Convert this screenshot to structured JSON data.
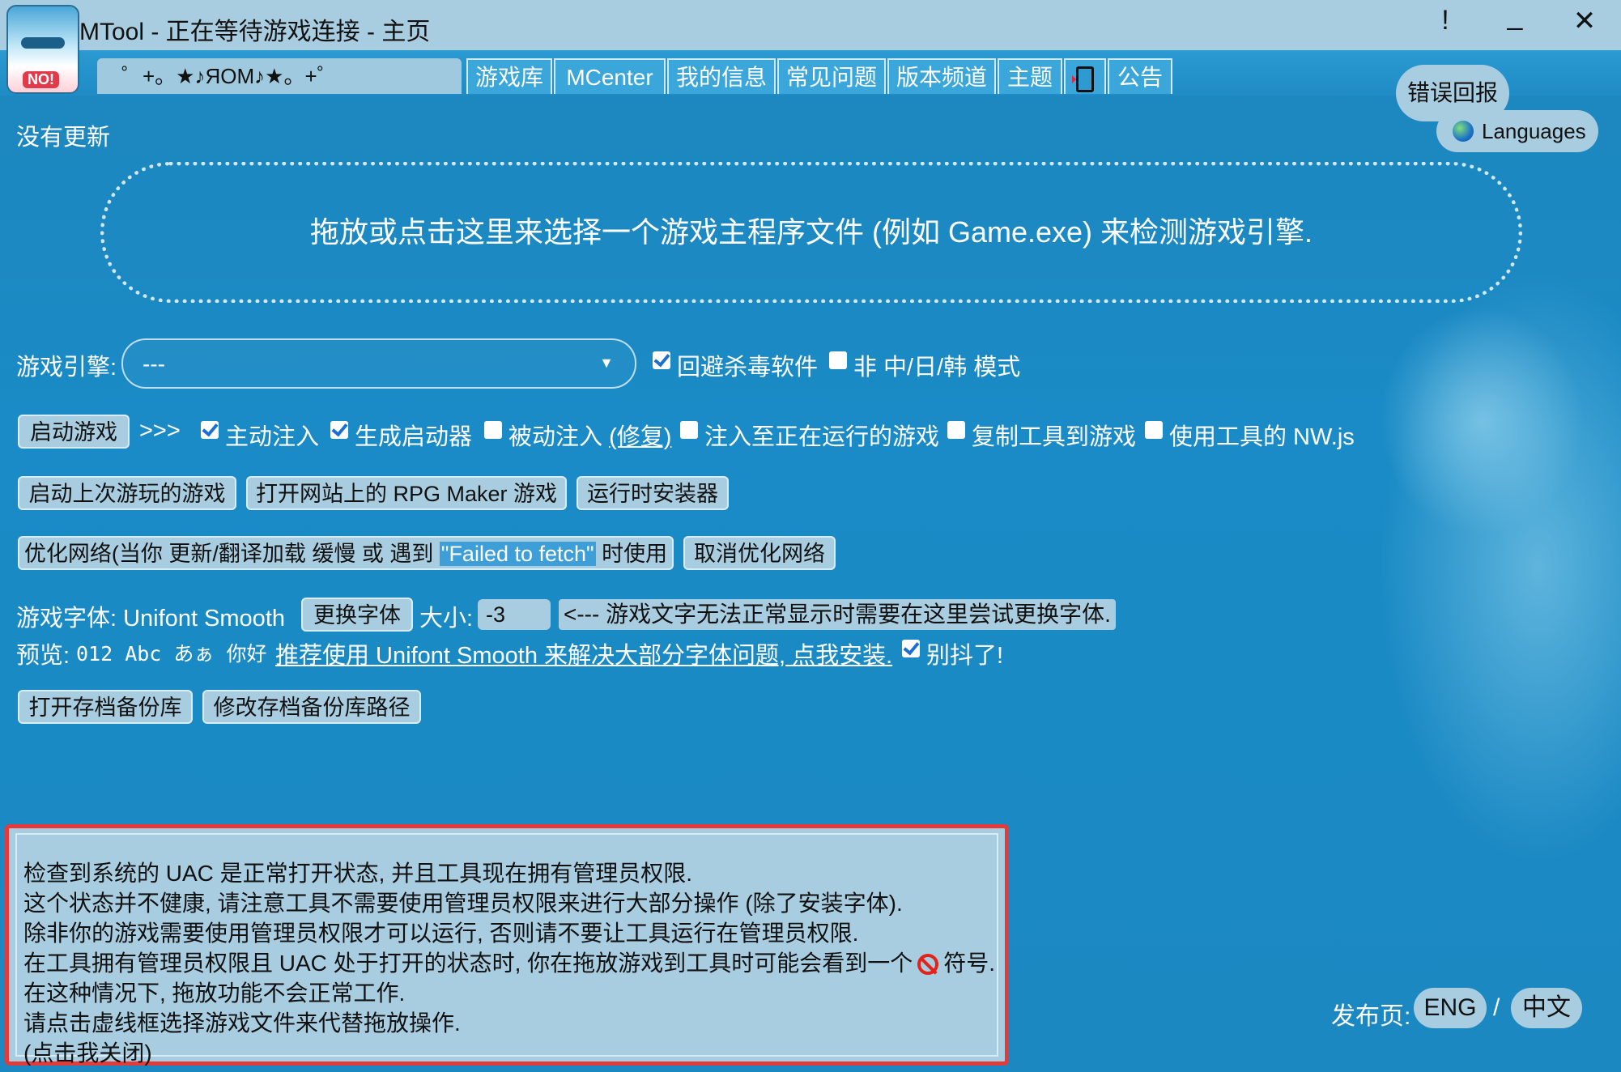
{
  "window": {
    "title": "MTool - 正在等待游戏连接 - 主页",
    "avatar_badge": "NO!",
    "motto": "゜+。★♪ЯOM♪★。+゜",
    "report_button": "!",
    "minimize_button": "_",
    "close_button": "✕",
    "report_bubble": "错误回报",
    "languages_button": "Languages"
  },
  "tabs": [
    "游戏库",
    "MCenter",
    "我的信息",
    "常见问题",
    "版本频道",
    "主题",
    "",
    "公告"
  ],
  "status": "没有更新",
  "dropzone_text": "拖放或点击这里来选择一个游戏主程序文件 (例如 Game.exe) 来检测游戏引擎.",
  "engine": {
    "label": "游戏引擎:",
    "value": "---",
    "avoid_av": {
      "label": "回避杀毒软件",
      "checked": true
    },
    "non_cjk": {
      "label": "非 中/日/韩 模式",
      "checked": false
    }
  },
  "launch": {
    "button": "启动游戏",
    "arrows": ">>>",
    "options": [
      {
        "label": "主动注入",
        "checked": true
      },
      {
        "label": "生成启动器",
        "checked": true
      },
      {
        "label": "被动注入 ",
        "link": "(修复)",
        "checked": false
      },
      {
        "label": "注入至正在运行的游戏",
        "checked": false
      },
      {
        "label": "复制工具到游戏",
        "checked": false
      },
      {
        "label": "使用工具的 NW.js",
        "checked": false
      }
    ]
  },
  "buttons_row2": [
    "启动上次游玩的游戏",
    "打开网站上的 RPG Maker 游戏",
    "运行时安装器"
  ],
  "network": {
    "optimize_before": "优化网络(当你 更新/翻译加载 缓慢 或 遇到 ",
    "optimize_highlight": "\"Failed to fetch\"",
    "optimize_after": " 时使用",
    "cancel": "取消优化网络"
  },
  "font": {
    "label": "游戏字体: Unifont Smooth",
    "change_button": "更换字体",
    "size_label": "大小:",
    "size_value": "-3",
    "hint": "<--- 游戏文字无法正常显示时需要在这里尝试更换字体.",
    "preview_label": "预览:",
    "preview_sample": "012 Abc あぁ 你好",
    "recommend_link": "推荐使用 Unifont Smooth 来解决大部分字体问题, 点我安装.",
    "no_shake": {
      "label": "别抖了!",
      "checked": true
    }
  },
  "backup": [
    "打开存档备份库",
    "修改存档备份库路径"
  ],
  "notice": {
    "line1": "检查到系统的 UAC 是正常打开状态, 并且工具现在拥有管理员权限.",
    "line2": "这个状态并不健康, 请注意工具不需要使用管理员权限来进行大部分操作 (除了安装字体).",
    "line3": "除非你的游戏需要使用管理员权限才可以运行, 否则请不要让工具运行在管理员权限.",
    "line4a": "在工具拥有管理员权限且 UAC 处于打开的状态时, 你在拖放游戏到工具时可能会看到一个",
    "line4b": "符号.",
    "line5": "在这种情况下, 拖放功能不会正常工作.",
    "line6": "请点击虚线框选择游戏文件来代替拖放操作.",
    "line7": "(点击我关闭)"
  },
  "release": {
    "label": "发布页:",
    "eng": "ENG",
    "sep": "/",
    "zh": "中文"
  }
}
